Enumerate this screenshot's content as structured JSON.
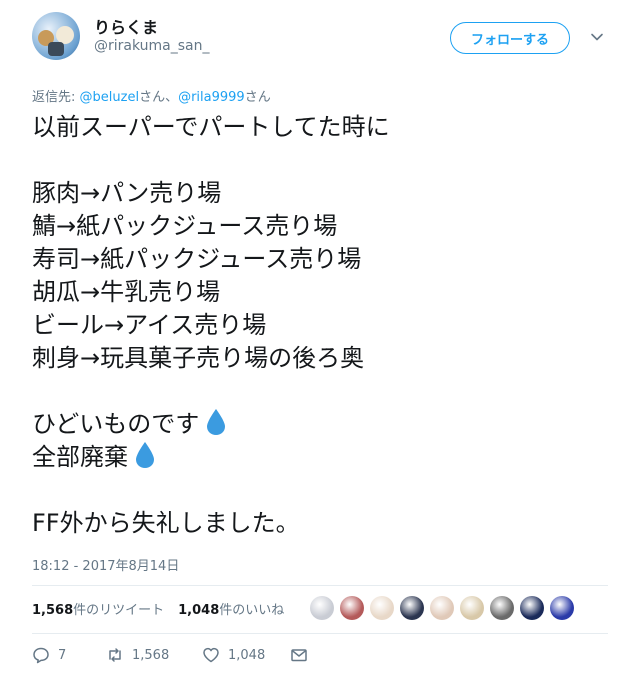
{
  "user": {
    "display_name": "りらくま",
    "handle": "@rirakuma_san_"
  },
  "follow_button": {
    "label": "フォローする"
  },
  "reply_context": {
    "prefix": "返信先: ",
    "mention1": "@beluzel",
    "sep": "さん、",
    "mention2": "@rila9999",
    "suffix": "さん"
  },
  "tweet": {
    "lines": [
      "以前スーパーでパートしてた時に",
      "",
      "豚肉→パン売り場",
      "鯖→紙パックジュース売り場",
      "寿司→紙パックジュース売り場",
      "胡瓜→牛乳売り場",
      "ビール→アイス売り場",
      "刺身→玩具菓子売り場の後ろ奥",
      "",
      "ひどいものです",
      "全部廃棄",
      "",
      "FF外から失礼しました。"
    ]
  },
  "timestamp": "18:12 - 2017年8月14日",
  "stats": {
    "retweets_count": "1,568",
    "retweets_label": "件のリツイート",
    "likes_count": "1,048",
    "likes_label": "件のいいね"
  },
  "liker_colors": [
    "#c9ccd4",
    "#b45a5a",
    "#e8d8c8",
    "#2b3550",
    "#e0c9b8",
    "#d8c8a8",
    "#6a6a6a",
    "#1a2a5a",
    "#2a3aa8"
  ],
  "actions": {
    "reply_count": "7",
    "retweet_count": "1,568",
    "like_count": "1,048"
  },
  "colors": {
    "accent": "#1da1f2",
    "muted": "#657786",
    "text": "#14171a"
  }
}
